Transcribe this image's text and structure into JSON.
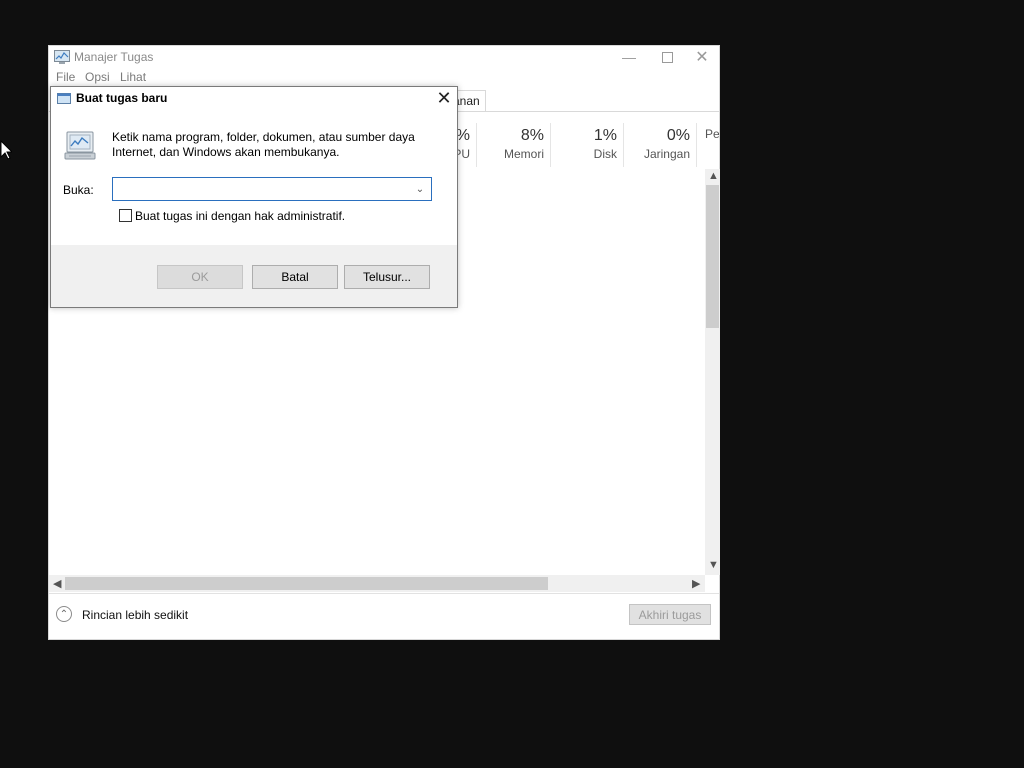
{
  "task_manager": {
    "title": "Manajer Tugas",
    "menu": [
      "File",
      "Opsi",
      "Lihat"
    ],
    "tab_visible_fragment": "anan",
    "columns": [
      {
        "pct": "%",
        "label": "PU"
      },
      {
        "pct": "8%",
        "label": "Memori"
      },
      {
        "pct": "1%",
        "label": "Disk"
      },
      {
        "pct": "0%",
        "label": "Jaringan"
      },
      {
        "pct": "",
        "label": "Per"
      }
    ],
    "fewer_details": "Rincian lebih sedikit",
    "end_task": "Akhiri tugas"
  },
  "run_dialog": {
    "title": "Buat tugas baru",
    "description": "Ketik nama program, folder, dokumen, atau sumber daya Internet, dan Windows akan membukanya.",
    "open_label": "Buka:",
    "open_value": "",
    "admin_checkbox_label": "Buat tugas ini dengan hak administratif.",
    "admin_checked": false,
    "ok": "OK",
    "cancel": "Batal",
    "browse": "Telusur..."
  }
}
